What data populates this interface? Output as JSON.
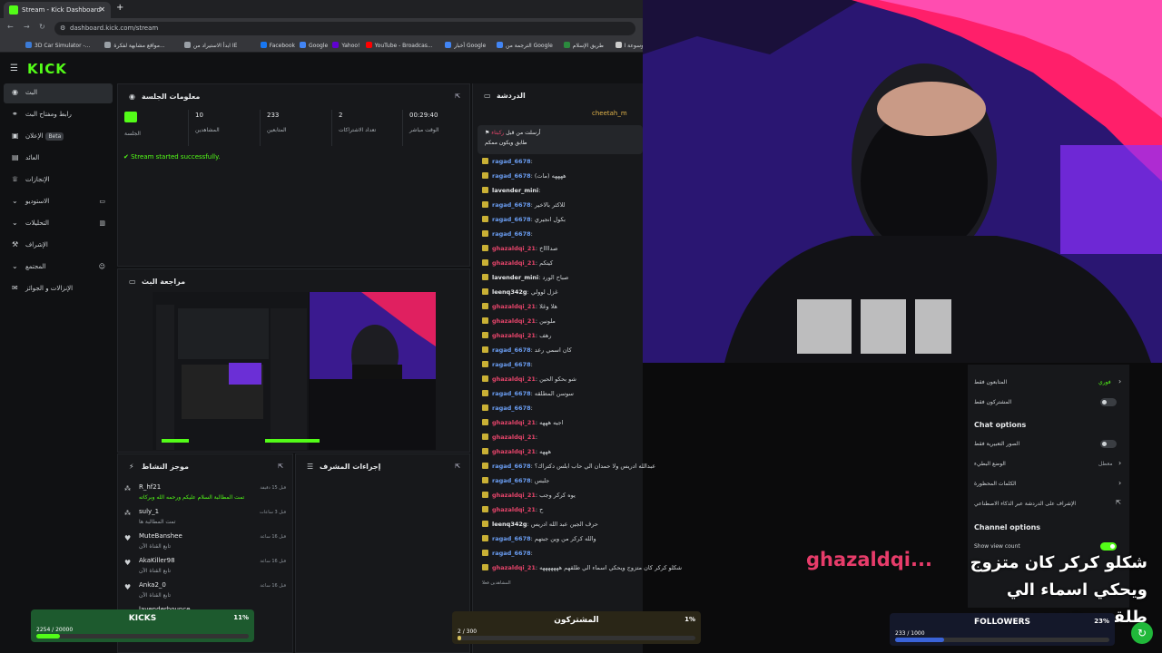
{
  "browser": {
    "tab_title": "Stream - Kick Dashboard",
    "new_tab": "+",
    "url": "dashboard.kick.com/stream",
    "bookmarks": [
      "3D Car Simulator -...",
      "مواقع مشابهة لفكرة...",
      "ابدأ الاستيراد من IE",
      "Facebook",
      "Google",
      "Yahoo!",
      "YouTube - Broadcas...",
      "أخبار Google",
      "الترجمة من Google",
      "طريق الإسلام",
      "ويكيبيديا الموسوعة ا..."
    ]
  },
  "app": {
    "logo": "KICK",
    "sidebar": [
      {
        "label": "البث",
        "icon": "broadcast-icon"
      },
      {
        "label": "رابط ومفتاح البث",
        "icon": "link-icon"
      },
      {
        "label": "الإعلان",
        "badge": "Beta",
        "icon": "megaphone-icon"
      },
      {
        "label": "العائد",
        "icon": "money-icon"
      },
      {
        "label": "الإنجازات",
        "icon": "trophy-icon"
      },
      {
        "label": "الاستوديو",
        "icon": "studio-icon"
      },
      {
        "label": "التحليلات",
        "icon": "chart-icon"
      },
      {
        "label": "الإشراف",
        "icon": "gavel-icon"
      },
      {
        "label": "المجتمع",
        "icon": "community-icon"
      },
      {
        "label": "الإنزالات و الجوائز",
        "icon": "gift-icon"
      }
    ]
  },
  "session": {
    "title": "معلومات الجلسة",
    "stats": [
      {
        "value": "",
        "label": "الجلسة",
        "is_badge": true
      },
      {
        "value": "10",
        "label": "المشاهدين"
      },
      {
        "value": "233",
        "label": "المتابعين"
      },
      {
        "value": "2",
        "label": "تعداد الاشتراكات"
      },
      {
        "value": "00:29:40",
        "label": "الوقت مباشر"
      }
    ],
    "status": "Stream started successfully."
  },
  "preview": {
    "title": "مراجعة البث"
  },
  "activity": {
    "title": "موجز النشاط",
    "events": [
      {
        "user": "R_hf21",
        "text": "تمت المطالبة السلام عليكم ورحمه الله وبركاته",
        "time": "قبل 15 دقيقة",
        "highlight": true
      },
      {
        "user": "suly_1",
        "text": "تمت المطالبة ها",
        "time": "قبل 3 ساعات",
        "highlight": false
      },
      {
        "user": "MuteBanshee",
        "text": "تابع القناة الآن",
        "time": "قبل 16 ساعة",
        "highlight": false
      },
      {
        "user": "AkaKiller98",
        "text": "تابع القناة الآن",
        "time": "قبل 16 ساعة",
        "highlight": false
      },
      {
        "user": "Anka2_0",
        "text": "تابع القناة الآن",
        "time": "قبل 16 ساعة",
        "highlight": false
      },
      {
        "user": "lavenderbounce",
        "text": "",
        "time": "",
        "highlight": false
      }
    ]
  },
  "mod": {
    "title": "إجراءات المشرف"
  },
  "chat": {
    "title": "الدردشة",
    "top_user": "cheetah_m",
    "pinned_by": "أرسلت من قبل",
    "pinned_user": "ركبتاء",
    "pinned_text": "طابق ويكون ممكم",
    "messages": [
      {
        "user": "ragad_6678",
        "text": "",
        "color": "#6a9df2"
      },
      {
        "user": "ragad_6678",
        "text": "ههههه (مات)",
        "color": "#6a9df2"
      },
      {
        "user": "lavender_mini",
        "text": "",
        "color": "#e6e8ea"
      },
      {
        "user": "ragad_6678",
        "text": "للاكثر بالاخير",
        "color": "#6a9df2"
      },
      {
        "user": "ragad_6678",
        "text": "بكول انجيري",
        "color": "#6a9df2"
      },
      {
        "user": "ragad_6678",
        "text": "",
        "color": "#6a9df2"
      },
      {
        "user": "ghazaldqi_21",
        "text": "صدااااخ",
        "color": "#e7456b"
      },
      {
        "user": "ghazaldqi_21",
        "text": "كيتكم",
        "color": "#e7456b"
      },
      {
        "user": "lavender_mini",
        "text": "صباح الورد",
        "color": "#e6e8ea"
      },
      {
        "user": "leenq342g",
        "text": "غزل لوولي",
        "color": "#e6e8ea"
      },
      {
        "user": "ghazaldqi_21",
        "text": "هلا وغلا",
        "color": "#e7456b"
      },
      {
        "user": "ghazaldqi_21",
        "text": "ملونين",
        "color": "#e7456b"
      },
      {
        "user": "ghazaldqi_21",
        "text": "رهف",
        "color": "#e7456b"
      },
      {
        "user": "ragad_6678",
        "text": "كان اسمي رعد",
        "color": "#6a9df2"
      },
      {
        "user": "ragad_6678",
        "text": "",
        "color": "#6a9df2"
      },
      {
        "user": "ghazaldqi_21",
        "text": "شو بحكو الحين",
        "color": "#e7456b"
      },
      {
        "user": "ragad_6678",
        "text": "سوسن المطلقه",
        "color": "#6a9df2"
      },
      {
        "user": "ragad_6678",
        "text": "",
        "color": "#6a9df2"
      },
      {
        "user": "ghazaldqi_21",
        "text": "اجيه هههه",
        "color": "#e7456b"
      },
      {
        "user": "ghazaldqi_21",
        "text": "",
        "color": "#e7456b"
      },
      {
        "user": "ghazaldqi_21",
        "text": "هههه",
        "color": "#e7456b"
      },
      {
        "user": "ragad_6678",
        "text": "عبدالله ادريس ولا حمدان الي حاب ابلس دكتراك؟",
        "color": "#6a9df2"
      },
      {
        "user": "ragad_6678",
        "text": "جلبس",
        "color": "#6a9df2"
      },
      {
        "user": "ghazaldqi_21",
        "text": "يوه كركر وجب",
        "color": "#e7456b"
      },
      {
        "user": "ghazaldqi_21",
        "text": "ح",
        "color": "#e7456b"
      },
      {
        "user": "leenq342g",
        "text": "حرف الجين عبد الله ادريس",
        "color": "#e6e8ea"
      },
      {
        "user": "ragad_6678",
        "text": "والله كركر من وين جبتهم",
        "color": "#6a9df2"
      },
      {
        "user": "ragad_6678",
        "text": "",
        "color": "#6a9df2"
      },
      {
        "user": "ghazaldqi_21",
        "text": "شكلو كركر كان متزوج ويحكي اسماء الي طلقهم هههههههه",
        "color": "#e7456b"
      }
    ],
    "footer": "المشاهدين فعلا"
  },
  "settings": {
    "rows": [
      {
        "label": "المتابعون فقط",
        "value": "فوري",
        "arrow": true
      },
      {
        "label": "المشتركون فقط",
        "toggle": false
      }
    ],
    "chat_options": "Chat options",
    "chat_rows": [
      {
        "label": "الصور التعبيرية فقط",
        "toggle": false
      },
      {
        "label": "الوضع البطيء",
        "value": "معطل",
        "arrow": true
      },
      {
        "label": "الكلمات المحظورة",
        "arrow": true
      },
      {
        "label": "الإشراف على الدردشة عبر الذكاء الاصطناعي",
        "arrow": true
      }
    ],
    "channel_options": "Channel options",
    "channel_rows": [
      {
        "label": "Show view count",
        "toggle": true
      }
    ]
  },
  "overlay": {
    "name": "ghazaldqi...",
    "message": "شكلو كركر كان متزوج ويحكي اسماء الي طلقهم هههههههه",
    "kicks": {
      "title": "KICKS",
      "pct": "11%",
      "count": "2254 / 20000",
      "ratio": 0.11,
      "color": "#53fc18"
    },
    "subs": {
      "title": "المشتركون",
      "pct": "1%",
      "count": "2 / 300",
      "ratio": 0.01,
      "color": "#d9c15a"
    },
    "followers": {
      "title": "FOLLOWERS",
      "pct": "23%",
      "count": "233 / 1000",
      "ratio": 0.23,
      "color": "#3a63d8"
    }
  }
}
